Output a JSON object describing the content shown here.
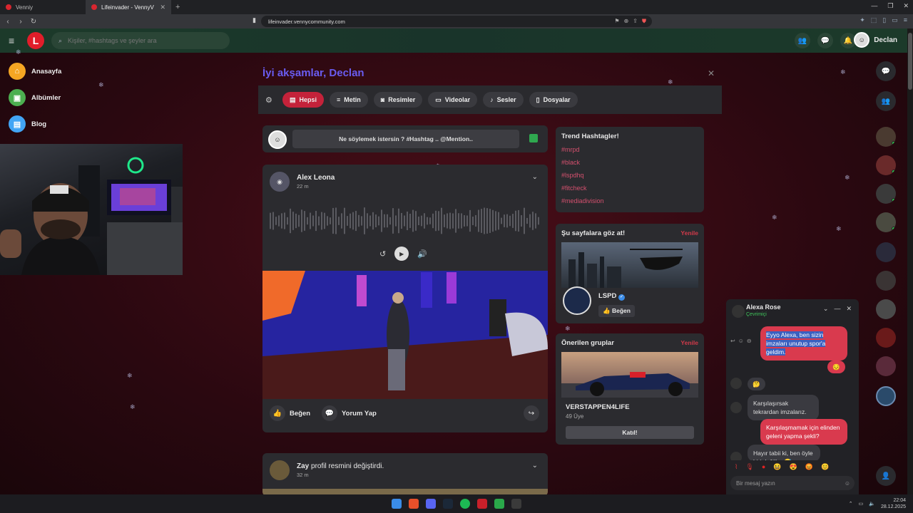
{
  "browser": {
    "tabs": [
      {
        "label": "Venniy",
        "active": false
      },
      {
        "label": "Lifeinvader - VennyV",
        "active": true
      }
    ],
    "url": "lifeinvader.vennycommunity.com"
  },
  "header": {
    "search_placeholder": "Kişiler, #hashtags ve şeyler ara",
    "user_name": "Declan",
    "logo_letter": "L"
  },
  "sidebar": {
    "items": [
      {
        "label": "Anasayfa",
        "icon": "home-icon",
        "color": "#f5a623"
      },
      {
        "label": "Albümler",
        "icon": "album-icon",
        "color": "#4caf50"
      },
      {
        "label": "Blog",
        "icon": "blog-icon",
        "color": "#42a5f5"
      }
    ]
  },
  "main": {
    "greeting": "İyi akşamlar, Declan",
    "filters": [
      "Hepsi",
      "Metin",
      "Resimler",
      "Videolar",
      "Sesler",
      "Dosyalar"
    ],
    "active_filter": "Hepsi",
    "composer_placeholder": "Ne söylemek istersin ? #Hashtag .. @Mention..",
    "post1": {
      "author": "Alex Leona",
      "time": "22 m",
      "like_label": "Beğen",
      "comment_label": "Yorum Yap"
    },
    "post2": {
      "author": "Zay",
      "action": "profil resmini değiştirdi.",
      "time": "32 m"
    }
  },
  "right": {
    "trend_title": "Trend Hashtagler!",
    "hashtags": [
      "#mrpd",
      "#black",
      "#lspdhq",
      "#fitcheck",
      "#mediadivision"
    ],
    "follow_title": "Şu sayfalara göz at!",
    "renew_label": "Yenile",
    "page_name": "LSPD",
    "page_like": "Beğen",
    "groups_title": "Önerilen gruplar",
    "group_name": "VERSTAPPEN4LIFE",
    "group_members": "49 Üye",
    "join_label": "Katıl!"
  },
  "chat": {
    "name": "Alexa Rose",
    "status": "Çevrimiçi",
    "messages": [
      {
        "from": "me",
        "text": "Eyyo Alexa, ben sizin imzaları unutup spor'a geldim."
      },
      {
        "from": "me",
        "text": "😔"
      },
      {
        "from": "them",
        "text": "🤔"
      },
      {
        "from": "them",
        "text": "Karşılaşırsak tekrardan imzalarız."
      },
      {
        "from": "me",
        "text": "Karşılaşmamak için elinden geleni yapma şekli?"
      },
      {
        "from": "them",
        "text": "Hayır tabii ki, ben öyle biri değilim 😅"
      }
    ],
    "input_placeholder": "Bir mesaj yazın"
  },
  "taskbar": {
    "time": "22:04",
    "date": "28.12.2025"
  },
  "colors": {
    "accent": "#c4223a",
    "header_green": "#1c3a2a",
    "greeting_purple": "#6a5cf0",
    "hashtag": "#d4506e"
  }
}
